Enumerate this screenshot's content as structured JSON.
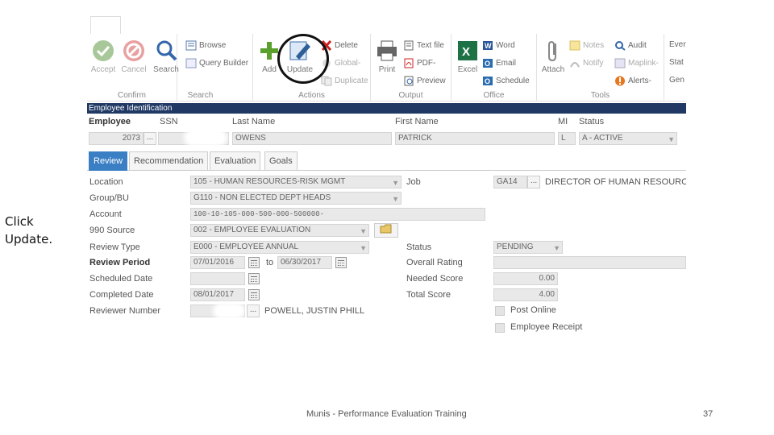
{
  "instruction": {
    "line1": "Click",
    "line2": "Update."
  },
  "footer": {
    "text": "Munis - Performance Evaluation Training",
    "page": "37"
  },
  "ribbon": {
    "confirm": {
      "label": "Confirm",
      "accept": "Accept",
      "cancel": "Cancel"
    },
    "search": {
      "label": "Search",
      "search": "Search",
      "browse": "Browse",
      "query_builder": "Query Builder"
    },
    "actions": {
      "label": "Actions",
      "add": "Add",
      "update": "Update",
      "delete": "Delete",
      "global": "Global-",
      "duplicate": "Duplicate"
    },
    "output": {
      "label": "Output",
      "print": "Print",
      "text_file": "Text file",
      "pdf": "PDF-",
      "preview": "Preview"
    },
    "office": {
      "label": "Office",
      "excel": "Excel",
      "word": "Word",
      "email": "Email",
      "schedule": "Schedule"
    },
    "tools": {
      "label": "Tools",
      "attach": "Attach",
      "notes": "Notes",
      "notify": "Notify",
      "audit": "Audit",
      "maplink": "Maplink-",
      "alerts": "Alerts-"
    },
    "extra": {
      "even": "Even",
      "stat": "Stat",
      "gen": "Gen"
    }
  },
  "employee_identification": {
    "section_title": "Employee Identification",
    "labels": {
      "employee": "Employee",
      "ssn": "SSN",
      "last_name": "Last Name",
      "first_name": "First Name",
      "mi": "MI",
      "status": "Status"
    },
    "values": {
      "employee": "2073",
      "last_name": "OWENS",
      "first_name": "PATRICK",
      "mi": "L",
      "status": "A - ACTIVE"
    }
  },
  "tabs": [
    "Review",
    "Recommendation",
    "Evaluation",
    "Goals"
  ],
  "form": {
    "location": {
      "label": "Location",
      "value": "105 - HUMAN RESOURCES-RISK MGMT"
    },
    "group_bu": {
      "label": "Group/BU",
      "value": "G110 - NON ELECTED DEPT HEADS"
    },
    "account": {
      "label": "Account",
      "value": "100-10-105-000-500-000-500000-"
    },
    "source_990": {
      "label": "990 Source",
      "value": "002 - EMPLOYEE EVALUATION"
    },
    "review_type": {
      "label": "Review Type",
      "value": "E000 - EMPLOYEE ANNUAL"
    },
    "review_period": {
      "label": "Review Period",
      "from": "07/01/2016",
      "to_label": "to",
      "to": "06/30/2017"
    },
    "scheduled_date": {
      "label": "Scheduled Date",
      "value": ""
    },
    "completed_date": {
      "label": "Completed Date",
      "value": "08/01/2017"
    },
    "reviewer_number": {
      "label": "Reviewer Number",
      "name": "POWELL, JUSTIN PHILL"
    },
    "job": {
      "label": "Job",
      "code": "GA14",
      "title": "DIRECTOR OF HUMAN RESOURCE"
    },
    "status": {
      "label": "Status",
      "value": "PENDING"
    },
    "overall_rating": {
      "label": "Overall Rating",
      "value": ""
    },
    "needed_score": {
      "label": "Needed Score",
      "value": "0.00"
    },
    "total_score": {
      "label": "Total Score",
      "value": "4.00"
    },
    "post_online": {
      "label": "Post Online"
    },
    "employee_receipt": {
      "label": "Employee Receipt"
    }
  }
}
